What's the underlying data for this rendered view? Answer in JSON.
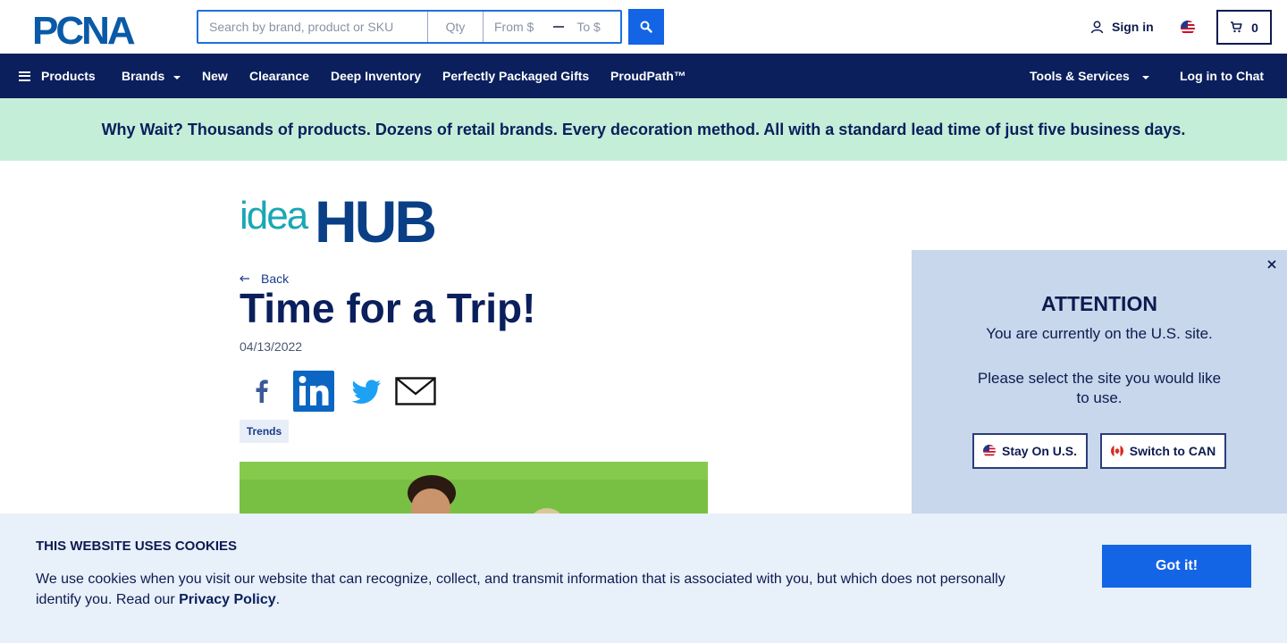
{
  "header": {
    "logo_text": "PCNA",
    "search": {
      "query_placeholder": "Search by brand, product or SKU",
      "qty_placeholder": "Qty",
      "from_placeholder": "From $",
      "to_placeholder": "To $"
    },
    "sign_in": "Sign in",
    "cart_count": "0"
  },
  "nav": {
    "items": [
      "Products",
      "Brands",
      "New",
      "Clearance",
      "Deep Inventory",
      "Perfectly Packaged Gifts",
      "ProudPath™"
    ],
    "tools": "Tools & Services",
    "chat": "Log in to Chat"
  },
  "promo": {
    "text": "Why Wait? Thousands of products. Dozens of retail brands. Every decoration method. All with a standard lead time of just five business days."
  },
  "article": {
    "brand_logo_text": "ideaHUB",
    "back": "Back",
    "title": "Time for a Trip!",
    "date": "04/13/2022",
    "tag": "Trends"
  },
  "attention": {
    "title": "ATTENTION",
    "current": "You are currently on the U.S. site.",
    "select": "Please select the site you would like to use.",
    "stay": "Stay On U.S.",
    "switch": "Switch to CAN"
  },
  "cookie": {
    "title": "THIS WEBSITE USES COOKIES",
    "text": "We use cookies when you visit our website that can recognize, collect, and transmit information that is associated with you, but which does not personally identify you. Read our",
    "link": "Privacy Policy",
    "period": ".",
    "button": "Got it!"
  },
  "colors": {
    "navy": "#0a1f5c",
    "blue": "#1464e6",
    "promo_bg": "#c5eed8",
    "popup_bg": "#c9d7ec",
    "cookie_bg": "#e8f0fa"
  }
}
